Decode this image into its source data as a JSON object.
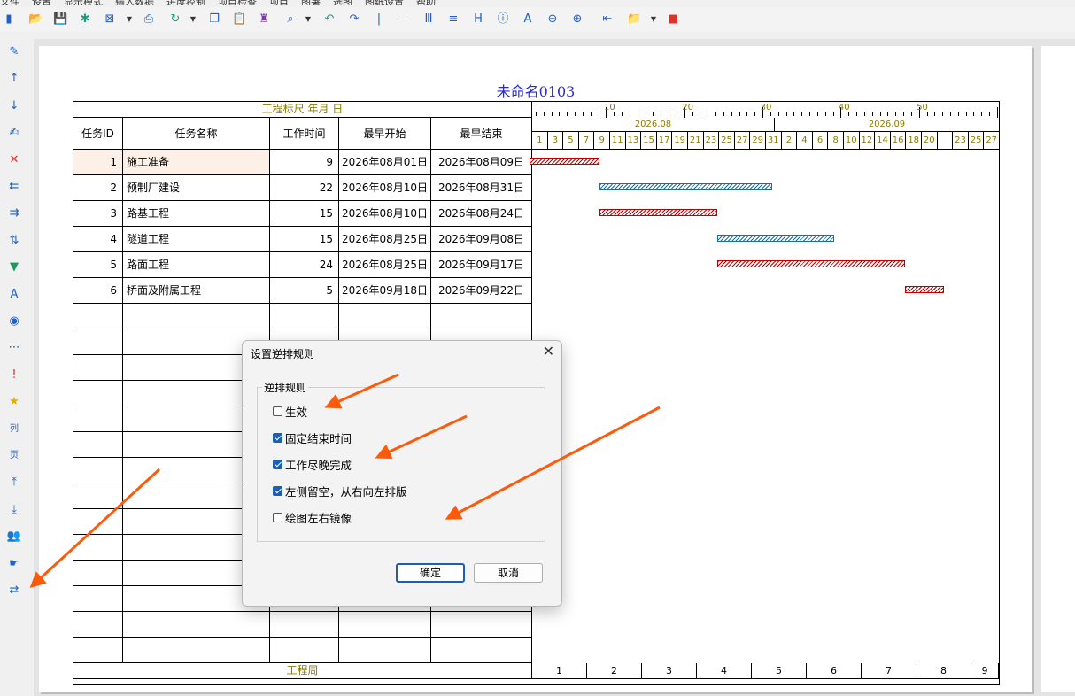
{
  "menubar": [
    "文件",
    "设置",
    "显示模式",
    "输入数据",
    "进度控制",
    "项目检查",
    "项目",
    "图署",
    "选图",
    "图纸设置",
    "帮助"
  ],
  "toolbar_icons": [
    "new-icon",
    "open-icon",
    "save-icon",
    "snowflake-icon",
    "export-icon",
    "print-icon",
    "refresh-icon",
    "copy-icon",
    "paste-icon",
    "brush-icon",
    "search-icon",
    "undo-icon",
    "redo-icon",
    "vline-icon",
    "hline-icon",
    "columns-icon",
    "indent-icon",
    "h-icon",
    "info-icon",
    "font-icon",
    "zoom-out-icon",
    "zoom-in-icon",
    "fit-icon",
    "folder-icon",
    "camera-icon"
  ],
  "left_toolbar_icons": [
    "pencil-icon",
    "arrow-up-icon",
    "arrow-down-icon",
    "edit-icon",
    "delete-icon",
    "outdent-icon",
    "indent-icon",
    "sort-icon",
    "filter-icon",
    "font-size-icon",
    "palette-icon",
    "dots-icon",
    "exclamation-icon",
    "star-icon",
    "column-icon",
    "page-icon",
    "move-top-icon",
    "move-bottom-icon",
    "users-icon",
    "hand-icon",
    "swap-icon"
  ],
  "left_toolbar_text": {
    "column": "列",
    "page": "页"
  },
  "document": {
    "title": "未命名0103",
    "ruler_label": "工程标尺 年月 日",
    "headers": {
      "id": "任务ID",
      "name": "任务名称",
      "duration": "工作时间",
      "start": "最早开始",
      "end": "最早结束"
    },
    "tasks": [
      {
        "id": "1",
        "name": "施工准备",
        "duration": "9",
        "start": "2026年08月01日",
        "end": "2026年08月09日",
        "color": "red"
      },
      {
        "id": "2",
        "name": "预制厂建设",
        "duration": "22",
        "start": "2026年08月10日",
        "end": "2026年08月31日",
        "color": "blue"
      },
      {
        "id": "3",
        "name": "路基工程",
        "duration": "15",
        "start": "2026年08月10日",
        "end": "2026年08月24日",
        "color": "red"
      },
      {
        "id": "4",
        "name": "隧道工程",
        "duration": "15",
        "start": "2026年08月25日",
        "end": "2026年09月08日",
        "color": "blue"
      },
      {
        "id": "5",
        "name": "路面工程",
        "duration": "24",
        "start": "2026年08月25日",
        "end": "2026年09月17日",
        "color": "red"
      },
      {
        "id": "6",
        "name": "桥面及附属工程",
        "duration": "5",
        "start": "2026年09月18日",
        "end": "2026年09月22日",
        "color": "red"
      }
    ],
    "ruler_numbers": [
      "10",
      "20",
      "30",
      "40",
      "50"
    ],
    "months": [
      "2026.08",
      "2026.09"
    ],
    "days": [
      "1",
      "3",
      "5",
      "7",
      "9",
      "11",
      "13",
      "15",
      "17",
      "19",
      "21",
      "23",
      "25",
      "27",
      "29",
      "31",
      "2",
      "4",
      "6",
      "8",
      "10",
      "12",
      "14",
      "16",
      "18",
      "20",
      "",
      "23",
      "25",
      "27"
    ],
    "week_label": "工程周",
    "weeks": [
      "1",
      "2",
      "3",
      "4",
      "5",
      "6",
      "7",
      "8",
      "9"
    ],
    "colors": {
      "critical": "#c00000",
      "normal": "#1a6ea8",
      "title": "#2a2ad0",
      "ruler": "#8a7a00"
    }
  },
  "dialog": {
    "title": "设置逆排规则",
    "group_label": "逆排规则",
    "options": [
      {
        "label": "生效",
        "checked": false
      },
      {
        "label": "固定结束时间",
        "checked": true
      },
      {
        "label": "工作尽晚完成",
        "checked": true
      },
      {
        "label": "左侧留空，从右向左排版",
        "checked": true
      },
      {
        "label": "绘图左右镜像",
        "checked": false
      }
    ],
    "ok": "确定",
    "cancel": "取消"
  },
  "annotation_color": "#ff5a0a"
}
